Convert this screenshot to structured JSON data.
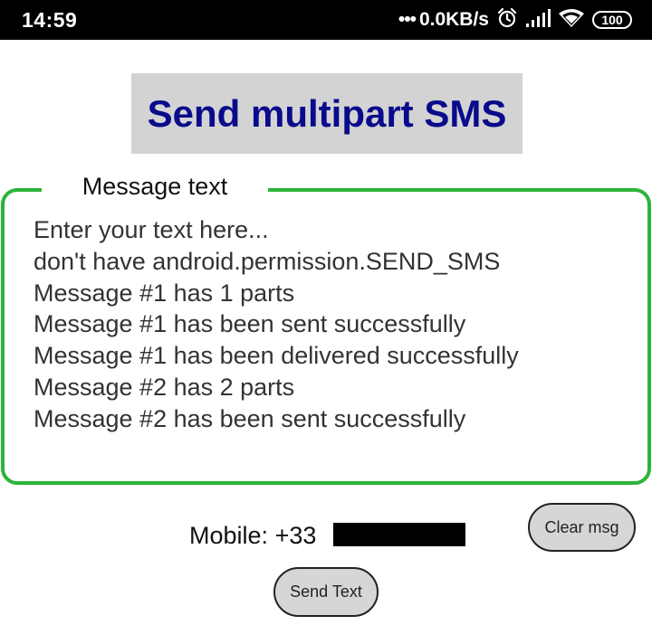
{
  "status_bar": {
    "time": "14:59",
    "dots": "•••",
    "net_speed": "0.0KB/s",
    "alarm_icon": "alarm-icon",
    "signal_icon": "signal-icon",
    "wifi_icon": "wifi-icon",
    "battery_level": "100"
  },
  "title": "Send multipart SMS",
  "message_box": {
    "legend": "Message text",
    "lines": [
      "Enter your text here...",
      "don't have android.permission.SEND_SMS",
      "Message #1 has 1 parts",
      "Message #1 has been sent successfully",
      "Message #1 has been delivered successfully",
      "Message #2 has 2 parts",
      "Message #2 has been sent successfully"
    ],
    "border_color": "#2db33a"
  },
  "mobile": {
    "label": "Mobile:",
    "number_visible": "+33"
  },
  "buttons": {
    "clear": "Clear msg",
    "send": "Send Text"
  },
  "colors": {
    "title": "#0a0a8c",
    "title_bg": "#d3d3d3",
    "button_bg": "#d6d6d6"
  }
}
